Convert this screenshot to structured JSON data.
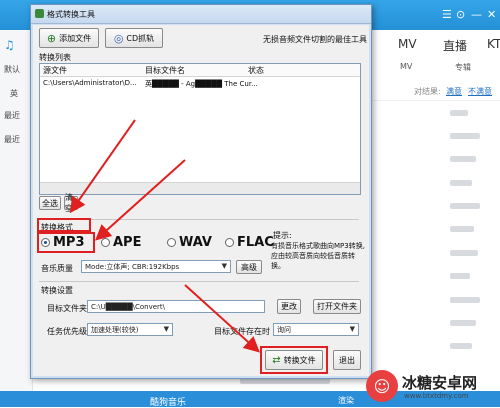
{
  "background_app": {
    "nav_tabs": [
      "MV",
      "直播",
      "KT"
    ],
    "subtabs": [
      "MV",
      "专辑"
    ],
    "result_prefix": "对结果:",
    "result_links": [
      "满意",
      "不满意"
    ],
    "left_items": [
      "默认",
      "英",
      "最近",
      "最近"
    ],
    "bottom_label": "酷狗音乐",
    "bottom_right": "渲染"
  },
  "dialog": {
    "title": "格式转换工具",
    "add_file_label": "添加文件",
    "cd_label": "CD抓轨",
    "slogan": "无损音频文件切割的最佳工具",
    "list_section_label": "转换列表",
    "columns": [
      "源文件",
      "目标文件名",
      "状态"
    ],
    "rows": [
      {
        "source": "C:\\Users\\Administrator\\D...",
        "target": "英█████ - Ag█████ The Cur...",
        "status": ""
      }
    ],
    "select_all_label": "全选",
    "clear_label": "清空",
    "format_section_label": "转换格式",
    "formats": [
      {
        "label": "MP3",
        "selected": true
      },
      {
        "label": "APE",
        "selected": false
      },
      {
        "label": "WAV",
        "selected": false
      },
      {
        "label": "FLAC",
        "selected": false
      }
    ],
    "tip_title": "提示:",
    "tip_text": "有损音乐格式歌曲向MP3转换,应由较高音质向较低音质转换。",
    "quality_label": "音乐质量",
    "quality_value": "Mode:立体声; CBR:192Kbps",
    "advanced_label": "高级",
    "settings_section_label": "转换设置",
    "target_folder_label": "目标文件夹",
    "target_folder_value": "C:\\U█████\\Convert\\",
    "change_label": "更改",
    "open_folder_label": "打开文件夹",
    "priority_label": "任务优先级",
    "priority_value": "加速处理(较快)",
    "exists_label": "目标文件存在时",
    "exists_value": "询问",
    "convert_label": "转换文件",
    "exit_label": "退出"
  },
  "watermark": {
    "text": "冰糖安卓网",
    "url": "www.btxtdmy.com"
  },
  "colors": {
    "accent_blue": "#2490d6",
    "highlight_red": "#e02020",
    "link_blue": "#1e6fc2"
  }
}
